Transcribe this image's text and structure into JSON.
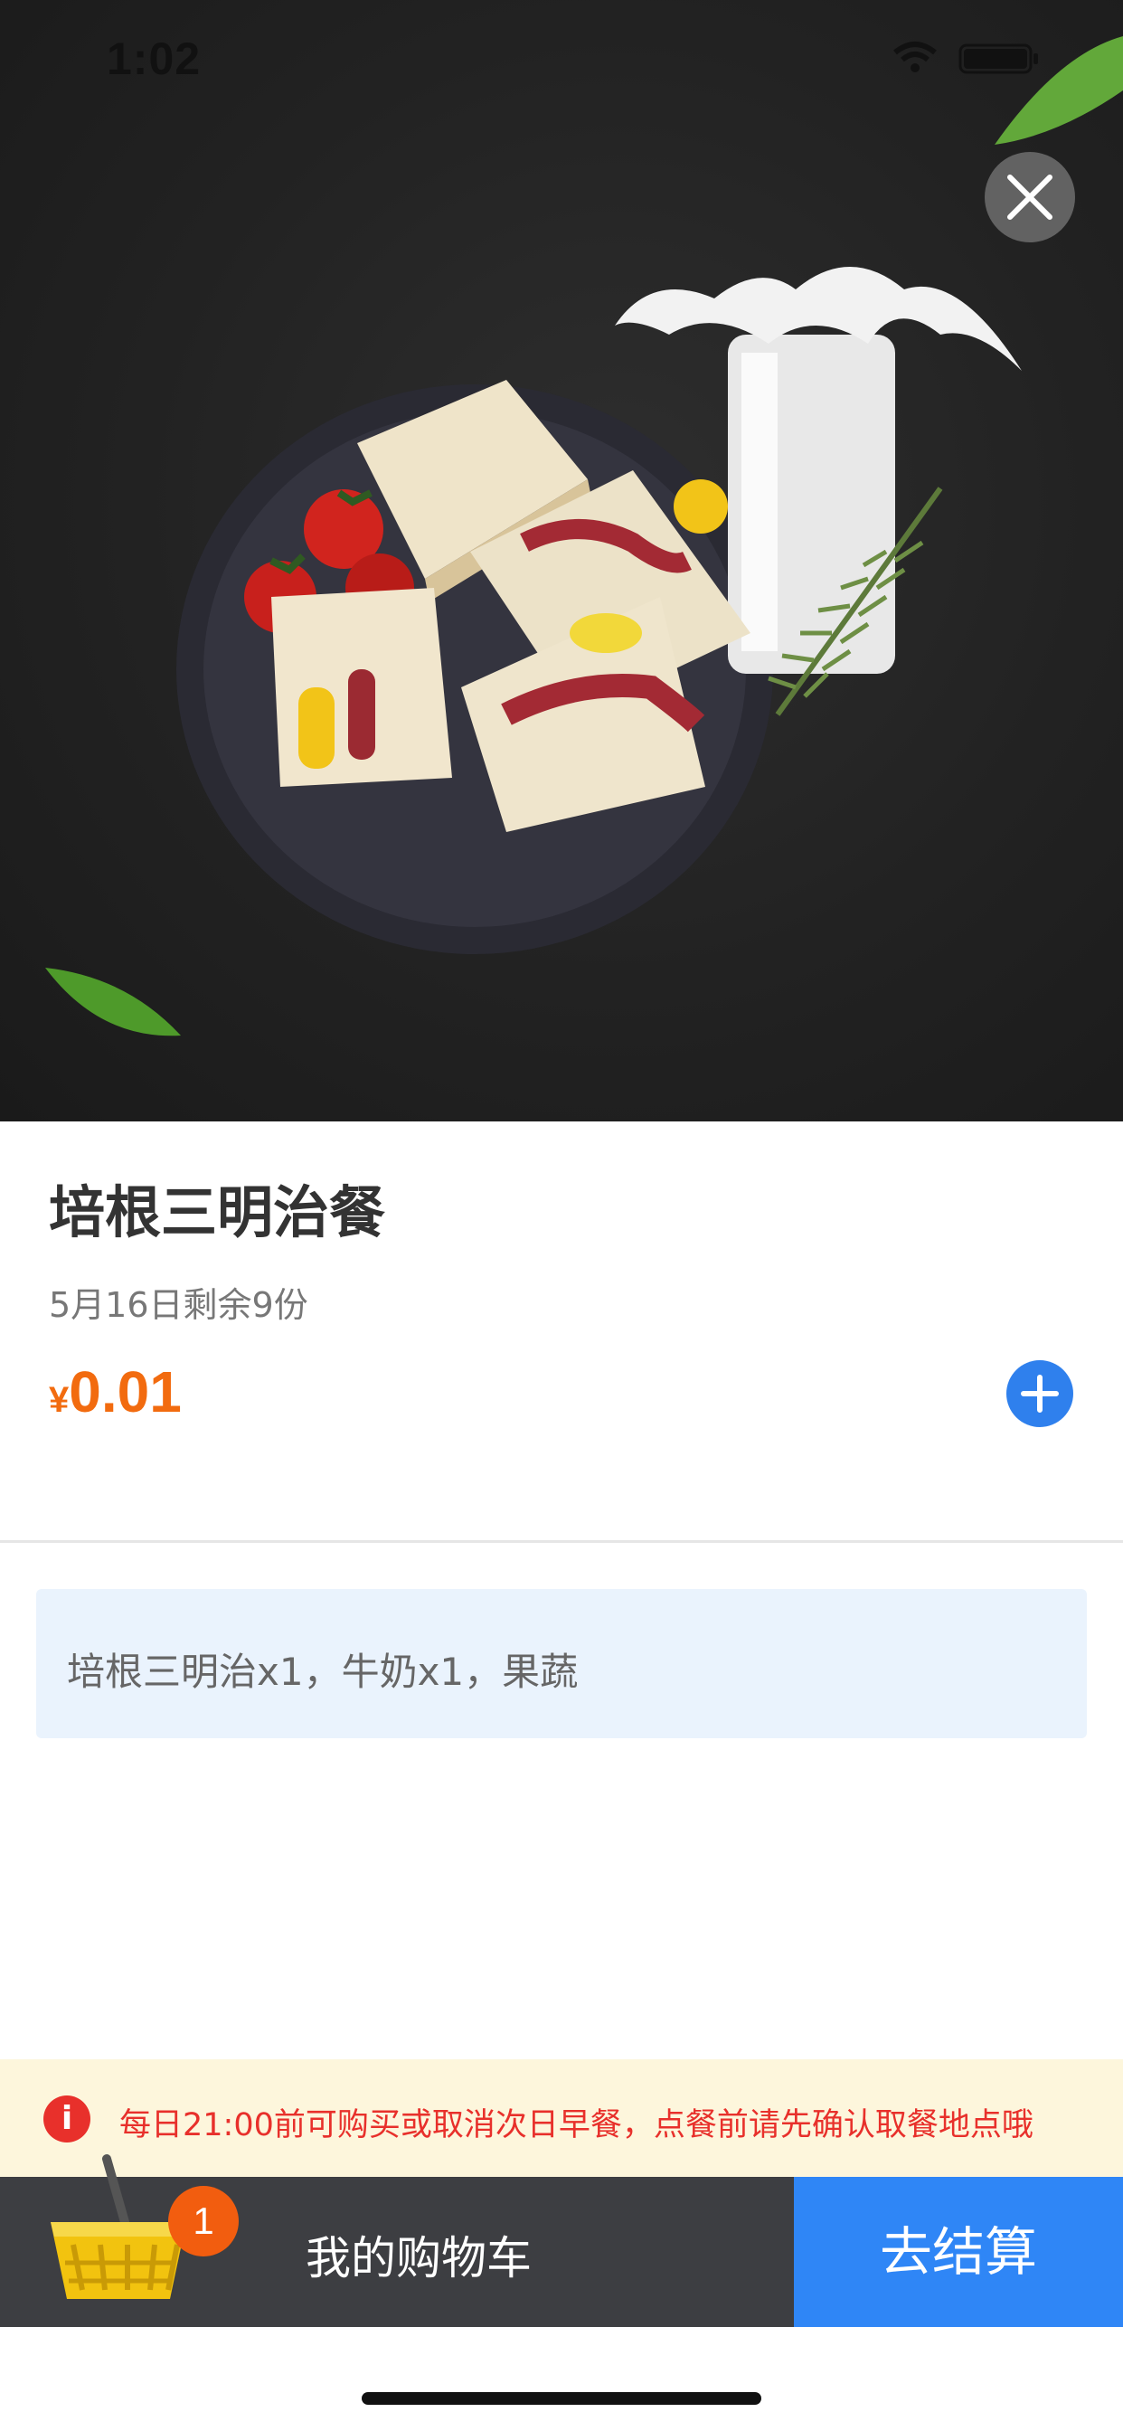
{
  "status_bar": {
    "time": "1:02",
    "icons": [
      "wifi-icon",
      "battery-icon"
    ]
  },
  "hero": {
    "close_icon": "close-icon"
  },
  "product": {
    "name": "培根三明治餐",
    "stock": "5月16日剩余9份",
    "currency": "¥",
    "price": "0.01",
    "add_icon": "plus-icon",
    "description": "培根三明治x1，牛奶x1，果蔬"
  },
  "notice": {
    "icon": "info-icon",
    "icon_glyph": "i",
    "text": "每日21:00前可购买或取消次日早餐，点餐前请先确认取餐地点哦"
  },
  "cart": {
    "basket_icon": "basket-icon",
    "count": "1",
    "label": "我的购物车",
    "checkout_label": "去结算"
  },
  "colors": {
    "price": "#f26b0f",
    "primary_blue": "#2f86f6",
    "notice_red": "#e8302b",
    "notice_bg": "#fdf6dc",
    "cart_bar_bg": "#3d3e42",
    "badge_orange": "#f25d0f",
    "desc_bg": "#eaf3fd"
  }
}
